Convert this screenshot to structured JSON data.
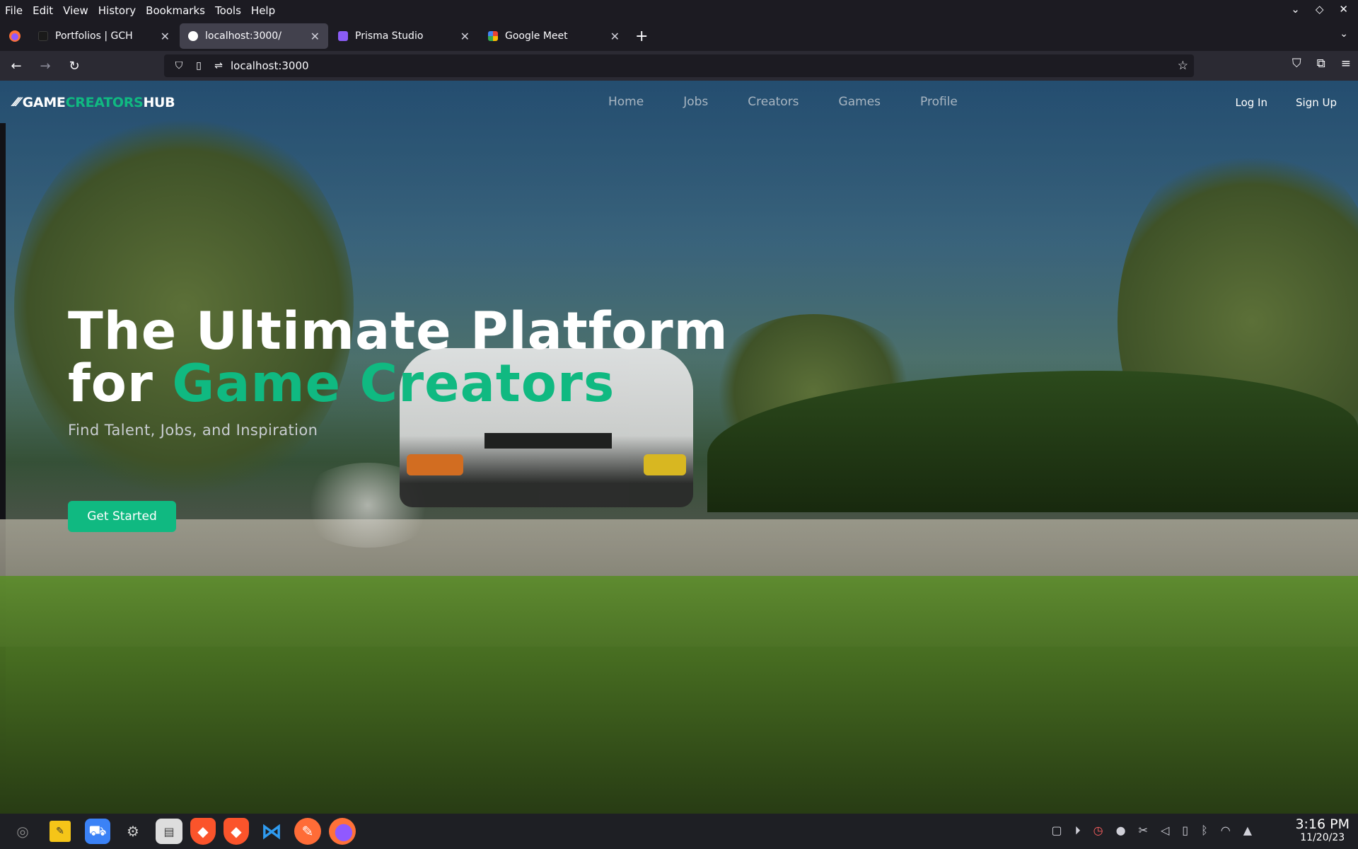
{
  "browser": {
    "menu": [
      "File",
      "Edit",
      "View",
      "History",
      "Bookmarks",
      "Tools",
      "Help"
    ],
    "tabs": [
      {
        "label": "Portfolios | GCH",
        "favicon_color": "#1a1a1a",
        "active": false
      },
      {
        "label": "localhost:3000/",
        "favicon_color": "#ffffff",
        "active": true
      },
      {
        "label": "Prisma Studio",
        "favicon_color": "#8b5cf6",
        "active": false
      },
      {
        "label": "Google Meet",
        "favicon_color": "#34a853",
        "active": false
      }
    ],
    "url": "localhost:3000"
  },
  "site": {
    "logo_white": "GAME",
    "logo_green": "CREATORS",
    "logo_white2": "HUB",
    "nav": [
      "Home",
      "Jobs",
      "Creators",
      "Games",
      "Profile"
    ],
    "login": "Log In",
    "signup": "Sign Up",
    "accent": "#10b981"
  },
  "hero": {
    "line1": "The Ultimate Platform",
    "line2_prefix": "for ",
    "line2_accent": "Game Creators",
    "subtitle": "Find Talent, Jobs, and Inspiration",
    "cta": "Get Started"
  },
  "taskbar": {
    "time": "3:16 PM",
    "date": "11/20/23"
  }
}
